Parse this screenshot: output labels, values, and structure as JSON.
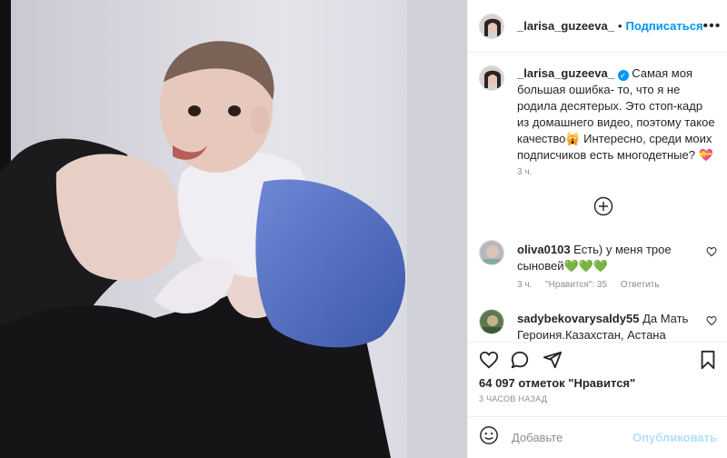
{
  "header": {
    "username": "_larisa_guzeeva_",
    "separator": "•",
    "follow_label": "Подписаться",
    "more_label": "•••"
  },
  "caption": {
    "username": "_larisa_guzeeva_",
    "text": "Самая моя большая ошибка- то, что я не родила десятерых. Это стоп-кадр из домашнего видео, поэтому такое качество🙀 Интересно, среди моих подписчиков есть многодетные? 💝",
    "time": "3 ч."
  },
  "comments": [
    {
      "username": "oliva0103",
      "text": "Есть) у меня трое сыновей💚💚💚",
      "time": "3 ч.",
      "likes": "\"Нравится\": 35",
      "reply": "Ответить"
    },
    {
      "username": "sadybekovarysaldy55",
      "text": "Да Мать Героиня.Казахстан, Астана"
    }
  ],
  "likes_text": "64 097 отметок \"Нравится\"",
  "posted_ago": "3 ЧАСОВ НАЗАД",
  "add_comment": {
    "placeholder": "Добавьте",
    "publish_label": "Опубликовать"
  },
  "icons": [
    "heart-icon",
    "comment-icon",
    "share-icon",
    "bookmark-icon",
    "plus-circle-icon",
    "smiley-icon"
  ],
  "colors": {
    "accent": "#0095f6",
    "muted": "#8e8e8e",
    "publish_disabled": "#b2dffc"
  }
}
